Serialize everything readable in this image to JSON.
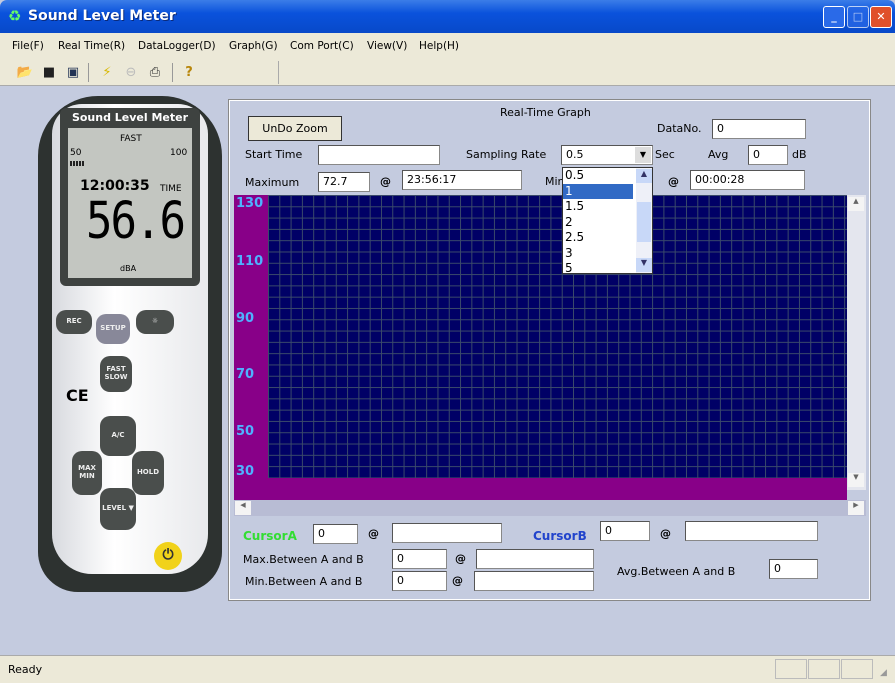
{
  "window": {
    "title": "Sound Level Meter",
    "minimize": "_",
    "maximize": "□",
    "close": "✕"
  },
  "menu": [
    "File(F)",
    "Real Time(R)",
    "DataLogger(D)",
    "Graph(G)",
    "Com Port(C)",
    "View(V)",
    "Help(H)"
  ],
  "toolbar": [
    "open-icon",
    "save-icon",
    "window-icon",
    "connect-icon",
    "stop-icon",
    "print-icon",
    "help-icon"
  ],
  "device": {
    "brand": "Sound Level Meter",
    "mode": "FAST",
    "bar_min": "50",
    "bar_max": "100",
    "time": "12:00:35",
    "time_label": "TIME",
    "reading": "56.6",
    "unit": "dBA",
    "keys": {
      "rec": "REC",
      "setup": "SETUP",
      "light": "☼",
      "fastslow": "FAST SLOW",
      "ac": "A/C",
      "maxmin": "MAX MIN",
      "hold": "HOLD",
      "level": "LEVEL ▼",
      "power": "⏻"
    },
    "ce": "CE"
  },
  "graph": {
    "title": "Real-Time Graph",
    "undo_zoom": "UnDo Zoom",
    "datano_label": "DataNo.",
    "datano": "0",
    "start_time_label": "Start Time",
    "start_time": "",
    "sampling_label": "Sampling Rate",
    "sampling_value": "0.5",
    "sec": "Sec",
    "avg_label": "Avg",
    "avg": "0",
    "db": "dB",
    "max_label": "Maximum",
    "max": "72.7",
    "at": "@",
    "max_time": "23:56:17",
    "min_label": "Min",
    "min_time": "00:00:28",
    "sampling_options": [
      "0.5",
      "1",
      "1.5",
      "2",
      "2.5",
      "3",
      "5"
    ],
    "selected_option": "1",
    "yticks": [
      "130",
      "110",
      "90",
      "70",
      "50",
      "30"
    ],
    "colors": {
      "plot_bg": "#000066",
      "axis_bg": "#880088",
      "tick": "#4fb2ff"
    }
  },
  "cursor": {
    "a_label": "CursorA",
    "a": "0",
    "a_time": "",
    "b_label": "CursorB",
    "b": "0",
    "b_time": "",
    "max_label": "Max.Between A and B",
    "max": "0",
    "max_time": "",
    "min_label": "Min.Between A and B",
    "min": "0",
    "min_time": "",
    "avg_label": "Avg.Between A and B",
    "avg": "0"
  },
  "status": {
    "text": "Ready"
  }
}
